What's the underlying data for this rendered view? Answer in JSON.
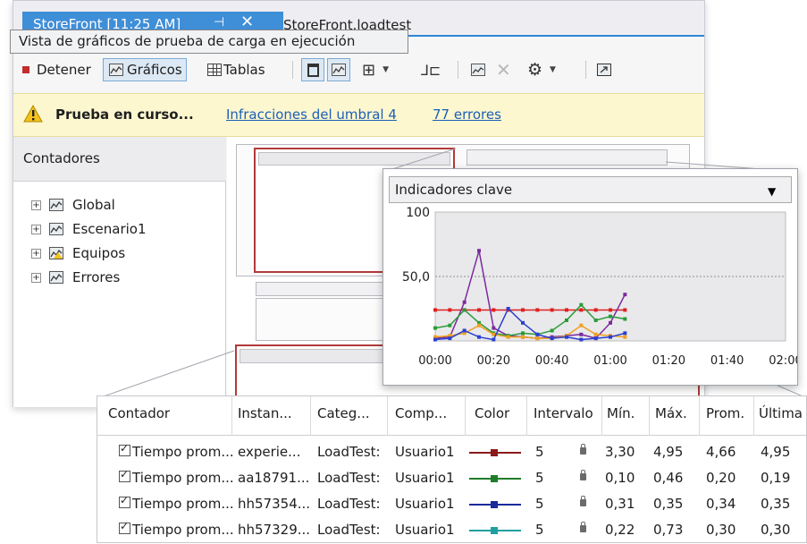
{
  "tabs": {
    "active_title": "StoreFront [11:25 AM]",
    "inactive_title": "StoreFront.loadtest"
  },
  "tooltip": "Vista de gráficos de prueba de carga en ejecución",
  "toolbar": {
    "stop_label": "Detener",
    "graphs_label": "Gráficos",
    "tables_label": "Tablas"
  },
  "status": {
    "message": "Prueba en curso...",
    "threshold_link": "Infracciones del umbral 4",
    "errors_link": "77 errores"
  },
  "counters_panel": {
    "header": "Contadores",
    "items": [
      {
        "label": "Global"
      },
      {
        "label": "Escenario1"
      },
      {
        "label": "Equipos"
      },
      {
        "label": "Errores"
      }
    ]
  },
  "chart_panel": {
    "selected": "Indicadores clave"
  },
  "chart_data": {
    "type": "line",
    "title": "",
    "xlabel": "",
    "ylabel": "",
    "ylim": [
      0,
      100
    ],
    "xlim": [
      0,
      120
    ],
    "y_tick_labels": [
      "100",
      "50,0"
    ],
    "x_tick_labels": [
      "00:00",
      "00:20",
      "00:40",
      "01:00",
      "01:20",
      "01:40",
      "02:00"
    ],
    "x": [
      0,
      5,
      10,
      15,
      20,
      25,
      30,
      35,
      40,
      45,
      50,
      55,
      60,
      65
    ],
    "series": [
      {
        "color": "#e02020",
        "values": [
          24,
          24,
          24,
          24,
          24,
          24,
          24,
          24,
          24,
          24,
          24,
          24,
          24,
          24
        ]
      },
      {
        "color": "#7d2a9e",
        "values": [
          2,
          3,
          30,
          70,
          10,
          4,
          3,
          2,
          3,
          4,
          5,
          2,
          14,
          36
        ]
      },
      {
        "color": "#2a9b3a",
        "values": [
          10,
          12,
          24,
          14,
          6,
          4,
          6,
          5,
          8,
          16,
          28,
          16,
          19,
          17
        ]
      },
      {
        "color": "#f0a020",
        "values": [
          3,
          4,
          6,
          12,
          5,
          3,
          3,
          2,
          2,
          4,
          12,
          5,
          4,
          3
        ]
      },
      {
        "color": "#2a3fd0",
        "values": [
          1,
          2,
          8,
          3,
          1,
          25,
          14,
          5,
          2,
          3,
          1,
          2,
          3,
          6
        ]
      }
    ]
  },
  "grid": {
    "headers": [
      "Contador",
      "Instan...",
      "Categ...",
      "Comp...",
      "Color",
      "Intervalo",
      "Mín.",
      "Máx.",
      "Prom.",
      "Última"
    ],
    "rows": [
      {
        "contador": "Tiempo prom...",
        "instancia": "experie...",
        "categoria": "LoadTest:",
        "computadora": "Usuario1",
        "color": "#8b1a1a",
        "intervalo": "5",
        "min": "3,30",
        "max": "4,95",
        "prom": "4,66",
        "ultima": "4,95"
      },
      {
        "contador": "Tiempo prom...",
        "instancia": "aa18791...",
        "categoria": "LoadTest:",
        "computadora": "Usuario1",
        "color": "#1f7d2a",
        "intervalo": "5",
        "min": "0,10",
        "max": "0,46",
        "prom": "0,20",
        "ultima": "0,19"
      },
      {
        "contador": "Tiempo prom...",
        "instancia": "hh57354...",
        "categoria": "LoadTest:",
        "computadora": "Usuario1",
        "color": "#1a2a9a",
        "intervalo": "5",
        "min": "0,31",
        "max": "0,35",
        "prom": "0,34",
        "ultima": "0,35"
      },
      {
        "contador": "Tiempo prom...",
        "instancia": "hh57329...",
        "categoria": "LoadTest:",
        "computadora": "Usuario1",
        "color": "#1fa0a0",
        "intervalo": "5",
        "min": "0,22",
        "max": "0,73",
        "prom": "0,30",
        "ultima": "0,30"
      }
    ]
  }
}
